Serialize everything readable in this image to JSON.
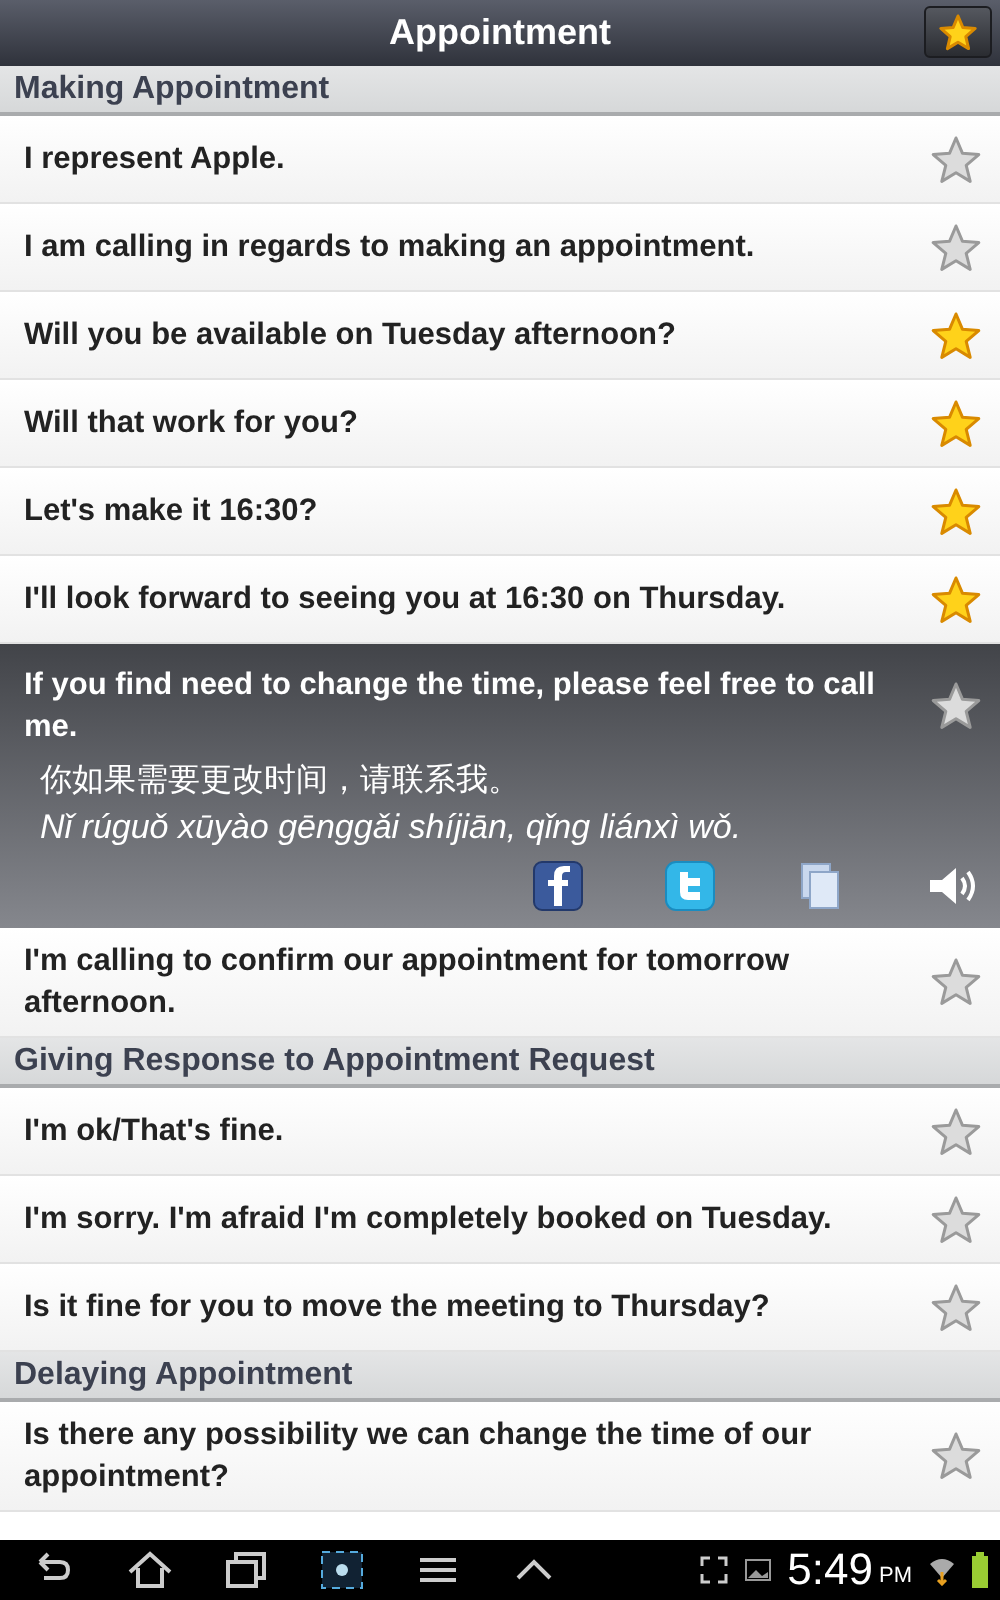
{
  "title_bar": {
    "title": "Appointment",
    "favorites_button": {
      "starred": true
    }
  },
  "sections": [
    {
      "title": "Making Appointment",
      "items": [
        {
          "text": "I represent Apple.",
          "starred": false,
          "expanded": false
        },
        {
          "text": "I am calling in regards to making an appointment.",
          "starred": false,
          "expanded": false
        },
        {
          "text": "Will you be available on Tuesday afternoon?",
          "starred": true,
          "expanded": false
        },
        {
          "text": "Will that work for you?",
          "starred": true,
          "expanded": false
        },
        {
          "text": "Let's make it 16:30?",
          "starred": true,
          "expanded": false
        },
        {
          "text": "I'll look forward to seeing you at 16:30 on Thursday.",
          "starred": true,
          "expanded": false
        },
        {
          "text": "If you find need to change the time, please feel free to call me.",
          "starred": false,
          "expanded": true,
          "translation": "你如果需要更改时间，请联系我。",
          "pinyin": "Nǐ rúguǒ xūyào gēnggǎi shíjiān, qǐng liánxì wǒ."
        },
        {
          "text": "I'm calling to confirm our appointment for tomorrow afternoon.",
          "starred": false,
          "expanded": false
        }
      ]
    },
    {
      "title": "Giving Response to Appointment Request",
      "items": [
        {
          "text": "I'm ok/That's fine.",
          "starred": false,
          "expanded": false
        },
        {
          "text": "I'm sorry. I'm afraid I'm completely booked on Tuesday.",
          "starred": false,
          "expanded": false
        },
        {
          "text": "Is it fine for you to move the meeting to Thursday?",
          "starred": false,
          "expanded": false
        }
      ]
    },
    {
      "title": "Delaying Appointment",
      "items": [
        {
          "text": "Is there any possibility we can change the time of our appointment?",
          "starred": false,
          "expanded": false
        }
      ]
    }
  ],
  "status_bar": {
    "time": "5:49",
    "period": "PM"
  }
}
